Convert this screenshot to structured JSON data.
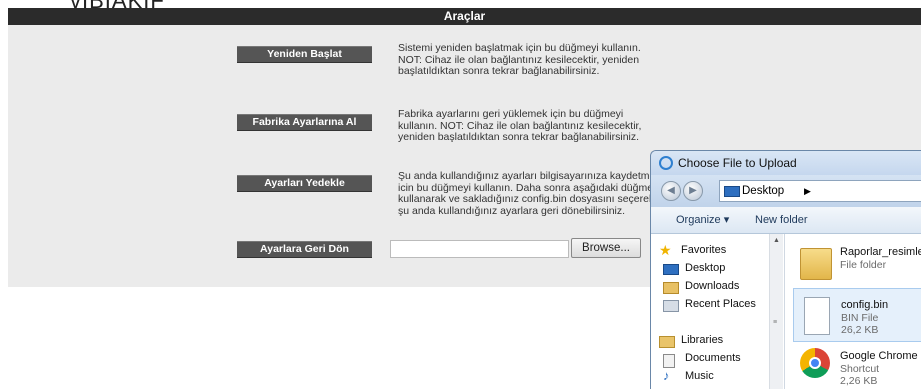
{
  "top_fragment": "vIBIAKIF",
  "page": {
    "title": "Araçlar",
    "actions": [
      {
        "button": "Yeniden Başlat",
        "description": "Sistemi yeniden başlatmak için bu düğmeyi kullanın. NOT: Cihaz ile olan bağlantınız kesilecektir, yeniden başlatıldıktan sonra tekrar bağlanabilirsiniz."
      },
      {
        "button": "Fabrika Ayarlarına Al",
        "description": "Fabrika ayarlarını geri yüklemek için bu düğmeyi kullanın. NOT: Cihaz ile olan bağlantınız kesilecektir, yeniden başlatıldıktan sonra tekrar bağlanabilirsiniz."
      },
      {
        "button": "Ayarları Yedekle",
        "description": "Şu anda kullandığınız ayarları bilgisayarınıza kaydetmek icin bu düğmeyi kullanın. Daha sonra aşağıdaki düğmeyi kullanarak ve sakladığınız config.bin dosyasını seçerek şu anda kullandığınız ayarlara geri dönebilirsiniz."
      },
      {
        "button": "Ayarlara Geri Dön",
        "description": ""
      }
    ],
    "file_input_value": "",
    "browse_label": "Browse..."
  },
  "dialog": {
    "title": "Choose File to Upload",
    "location": "Desktop",
    "organize_label": "Organize ▾",
    "new_folder_label": "New folder",
    "nav": [
      {
        "label": "Favorites",
        "icon": "star-icon"
      },
      {
        "label": "Desktop",
        "icon": "desktop-icon"
      },
      {
        "label": "Downloads",
        "icon": "downloads-icon"
      },
      {
        "label": "Recent Places",
        "icon": "recent-places-icon"
      },
      {
        "label": "Libraries",
        "icon": "libraries-icon"
      },
      {
        "label": "Documents",
        "icon": "documents-icon"
      },
      {
        "label": "Music",
        "icon": "music-icon"
      }
    ],
    "files": [
      {
        "name": "Raporlar_resimler",
        "type": "File folder",
        "size": "",
        "icon": "folder-icon"
      },
      {
        "name": "config.bin",
        "type": "BIN File",
        "size": "26,2 KB",
        "icon": "file-icon",
        "selected": true
      },
      {
        "name": "Google Chrome",
        "type": "Shortcut",
        "size": "2,26 KB",
        "icon": "chrome-icon"
      }
    ]
  },
  "colors": {
    "title_bar": "#2b2b2b",
    "panel": "#ebebeb",
    "button": "#555555",
    "dialog_frame": "#c9dbef"
  }
}
